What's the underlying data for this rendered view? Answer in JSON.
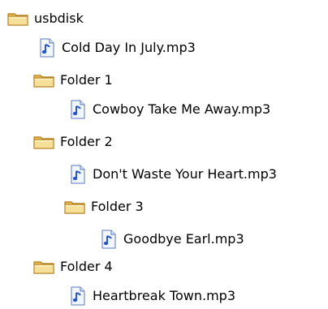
{
  "tree": {
    "root": {
      "label": "usbdisk",
      "icon": "folder-icon"
    },
    "items": [
      {
        "label": "Cold Day In July.mp3",
        "icon": "audio-file-icon"
      },
      {
        "label": "Folder 1",
        "icon": "folder-icon"
      },
      {
        "label": "Cowboy Take Me Away.mp3",
        "icon": "audio-file-icon"
      },
      {
        "label": "Folder 2",
        "icon": "folder-icon"
      },
      {
        "label": "Don't Waste Your Heart.mp3",
        "icon": "audio-file-icon"
      },
      {
        "label": "Folder 3",
        "icon": "folder-icon"
      },
      {
        "label": "Goodbye Earl.mp3",
        "icon": "audio-file-icon"
      },
      {
        "label": "Folder 4",
        "icon": "folder-icon"
      },
      {
        "label": "Heartbreak Town.mp3",
        "icon": "audio-file-icon"
      }
    ]
  },
  "colors": {
    "folder_fill": "#e8c15a",
    "folder_outline": "#b07a18",
    "folder_highlight": "#f6df98",
    "file_fill": "#f2f6ff",
    "file_outline": "#5a7bb8",
    "note_color": "#2a56c6",
    "text": "#000000"
  }
}
